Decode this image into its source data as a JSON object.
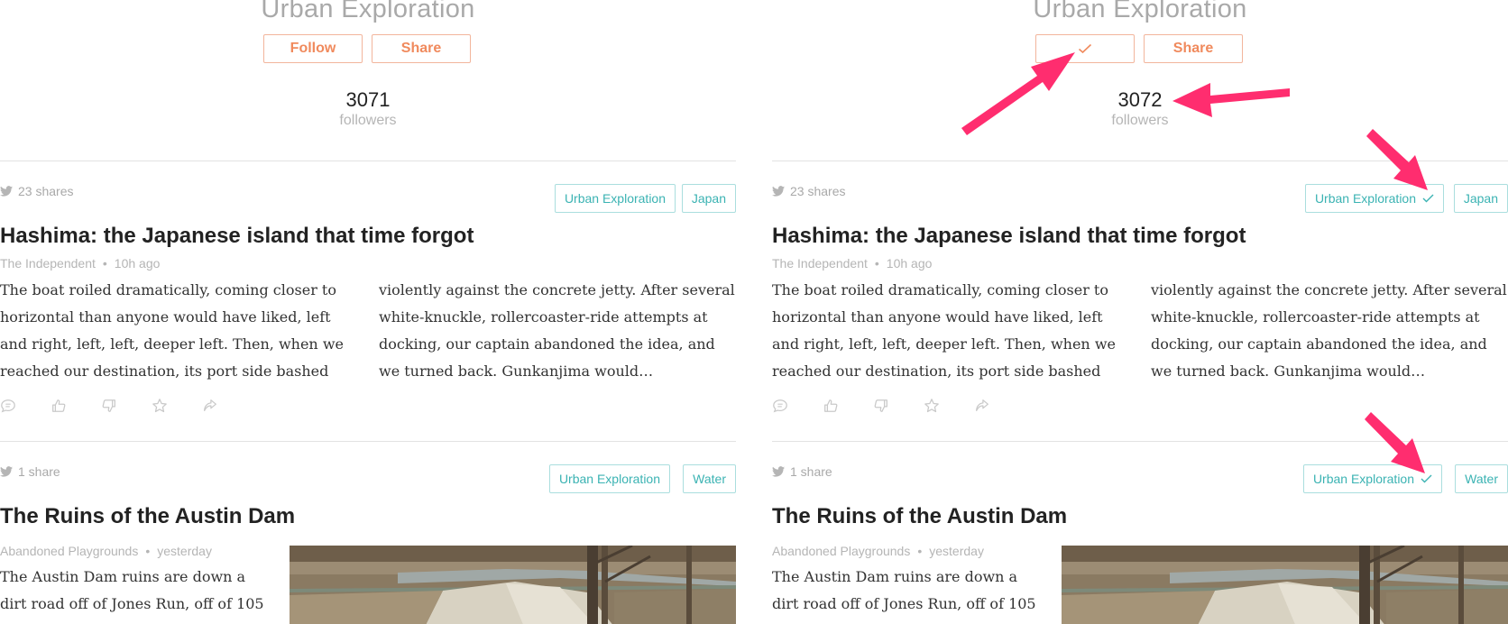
{
  "colors": {
    "accent_orange": "#f08a5d",
    "tag_teal": "#3bb3b3",
    "annotation_pink": "#ff2d6f",
    "muted_gray": "#b5b5b5"
  },
  "left": {
    "topic_title": "Urban Exploration",
    "follow_label": "Follow",
    "follow_state": "text",
    "share_label": "Share",
    "followers_count": "3071",
    "followers_label": "followers",
    "articles": [
      {
        "shares": "23 shares",
        "tags": [
          {
            "label": "Urban Exploration",
            "checked": false
          },
          {
            "label": "Japan",
            "checked": false
          }
        ],
        "title": "Hashima: the Japanese island that time forgot",
        "source": "The Independent",
        "time": "10h ago",
        "col1": "The boat roiled dramatically, coming closer to horizontal than anyone would have liked, left and right, left, left, deeper left. Then, when we reached our destination, its port side bashed",
        "col2": "violently against the concrete jetty. After several white-knuckle, rollercoaster-ride attempts at docking, our captain abandoned the idea, and we turned back. Gunkanjima would…"
      },
      {
        "shares": "1 share",
        "tags": [
          {
            "label": "Urban Exploration",
            "checked": false
          },
          {
            "label": "Water",
            "checked": false
          }
        ],
        "title": "The Ruins of the Austin Dam",
        "source": "Abandoned Playgrounds",
        "time": "yesterday",
        "col1": "The Austin Dam ruins are down a dirt road off of Jones Run, off of 105"
      }
    ]
  },
  "right": {
    "topic_title": "Urban Exploration",
    "follow_label": "",
    "follow_state": "check",
    "share_label": "Share",
    "followers_count": "3072",
    "followers_label": "followers",
    "articles": [
      {
        "shares": "23 shares",
        "tags": [
          {
            "label": "Urban Exploration",
            "checked": true
          },
          {
            "label": "Japan",
            "checked": false
          }
        ],
        "title": "Hashima: the Japanese island that time forgot",
        "source": "The Independent",
        "time": "10h ago",
        "col1": "The boat roiled dramatically, coming closer to horizontal than anyone would have liked, left and right, left, left, deeper left. Then, when we reached our destination, its port side bashed",
        "col2": "violently against the concrete jetty. After several white-knuckle, rollercoaster-ride attempts at docking, our captain abandoned the idea, and we turned back. Gunkanjima would…"
      },
      {
        "shares": "1 share",
        "tags": [
          {
            "label": "Urban Exploration",
            "checked": true
          },
          {
            "label": "Water",
            "checked": false
          }
        ],
        "title": "The Ruins of the Austin Dam",
        "source": "Abandoned Playgrounds",
        "time": "yesterday",
        "col1": "The Austin Dam ruins are down a dirt road off of Jones Run, off of 105"
      }
    ]
  },
  "icons": {
    "shares": "twitter-bird-icon",
    "actions": [
      "comment-icon",
      "thumbs-up-icon",
      "thumbs-down-icon",
      "star-icon",
      "share-arrow-icon"
    ],
    "annotations": "arrow-annotation-icon"
  }
}
